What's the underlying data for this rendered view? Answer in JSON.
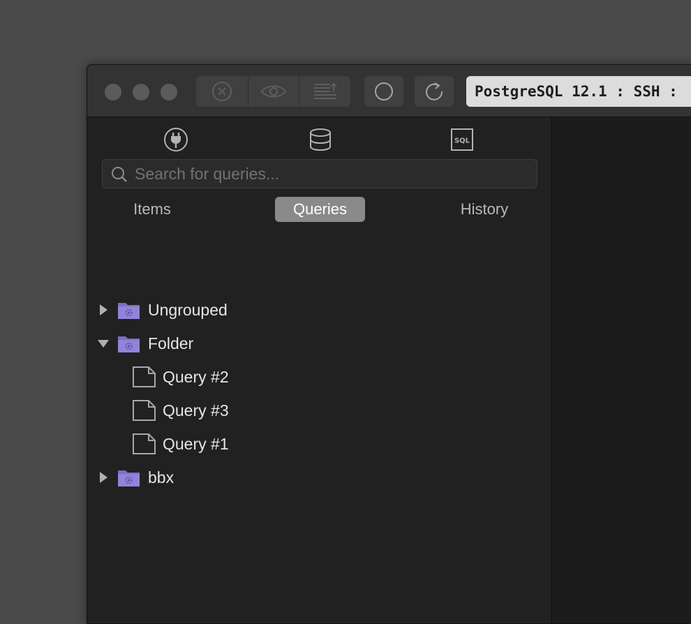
{
  "toolbar": {
    "connection_label": "PostgreSQL 12.1 : SSH : "
  },
  "sidebar": {
    "mode_icons": [
      "plug-icon",
      "database-icon",
      "sql-icon"
    ],
    "sql_icon_text": "SQL",
    "search_placeholder": "Search for queries...",
    "tabs": [
      {
        "label": "Items"
      },
      {
        "label": "Queries",
        "selected": true
      },
      {
        "label": "History"
      }
    ],
    "tree": {
      "ungrouped": {
        "label": "Ungrouped",
        "expanded": false
      },
      "folder": {
        "label": "Folder",
        "expanded": true,
        "children": [
          "Query #2",
          "Query #3",
          "Query #1"
        ]
      },
      "bbx": {
        "label": "bbx",
        "expanded": false
      }
    }
  },
  "colors": {
    "folder": "#8a7fd6",
    "tab_active": "#8a8a8a",
    "window_bg": "#202020",
    "titlebar_bg": "#333333"
  }
}
